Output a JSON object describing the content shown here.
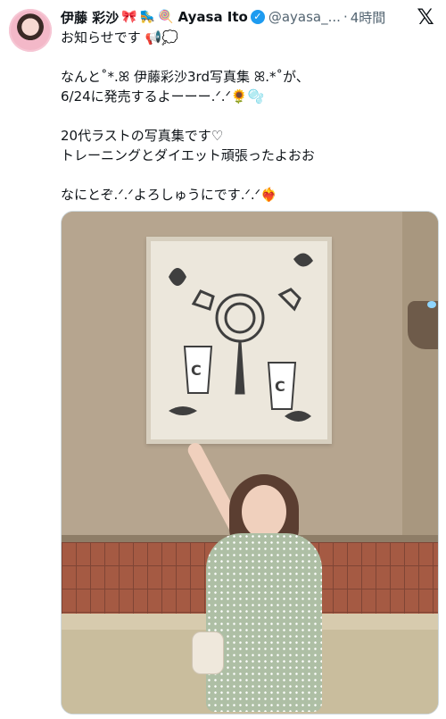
{
  "author": {
    "name_jp": "伊藤 彩沙",
    "name_emojis": [
      "🎀",
      "🛼",
      "🍭"
    ],
    "name_en": "Ayasa Ito",
    "verified_glyph": "✓",
    "handle": "@ayasa_...",
    "separator": "·",
    "time": "4時間"
  },
  "x_logo": "𝕏",
  "tweet": {
    "lines": [
      "お知らせです 📢💭",
      "",
      "なんと˚*.ꕤ 伊藤彩沙3rd写真集 ꕤ.*˚が、",
      "6/24に発売するよーーー.ᐟ.ᐟ🌻🫧",
      "",
      "20代ラストの写真集です♡",
      "トレーニングとダイエット頑張ったよおお",
      "",
      "なにとぞ.ᐟ.ᐟよろしゅうにです.ᐟ.ᐟ❤️‍🔥"
    ]
  },
  "colors": {
    "text": "#0f1419",
    "muted": "#536471",
    "verified": "#1d9bf0",
    "wall": "#b6a58f",
    "tiles": "#a55a43",
    "bench": "#c9bd9d",
    "dress": "#aebfa5"
  }
}
